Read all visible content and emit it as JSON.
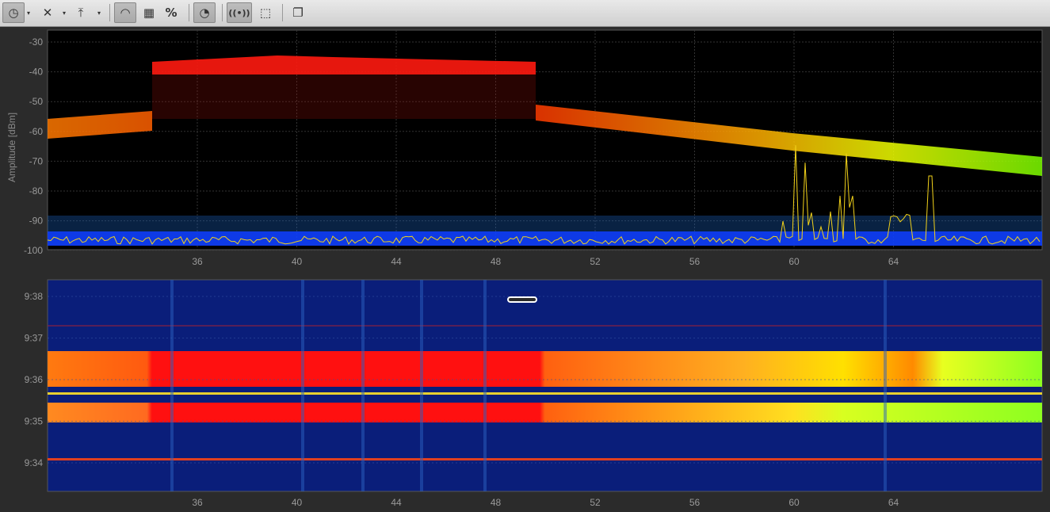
{
  "toolbar": {
    "buttons": [
      {
        "name": "clock-icon",
        "glyph": "◷"
      },
      {
        "name": "clear-icon",
        "glyph": "✕"
      },
      {
        "name": "peak-hold-icon",
        "glyph": "⤒"
      },
      {
        "name": "gauge-icon",
        "glyph": "◠"
      },
      {
        "name": "density-icon",
        "glyph": "▦"
      },
      {
        "name": "percent-icon",
        "glyph": "%"
      },
      {
        "name": "wifi-icon",
        "glyph": "◔"
      },
      {
        "name": "broadcast-icon",
        "glyph": "((•))"
      },
      {
        "name": "selection-icon",
        "glyph": "⬚"
      },
      {
        "name": "window-icon",
        "glyph": "❐"
      }
    ]
  },
  "spectrum": {
    "ylabel": "Amplitude [dBm]",
    "yticks": [
      "-30",
      "-40",
      "-50",
      "-60",
      "-70",
      "-80",
      "-90",
      "-100"
    ],
    "xticks": [
      "36",
      "40",
      "44",
      "48",
      "52",
      "56",
      "60",
      "64"
    ]
  },
  "waterfall": {
    "yticks": [
      "9:38",
      "9:37",
      "9:36",
      "9:35",
      "9:34"
    ],
    "xticks": [
      "36",
      "40",
      "44",
      "48",
      "52",
      "56",
      "60",
      "64"
    ]
  },
  "colors": {
    "background": "#000000",
    "waterfall_bg": "#0a1e7a",
    "trace": "#f2d21a",
    "floor": "#1040ff"
  }
}
